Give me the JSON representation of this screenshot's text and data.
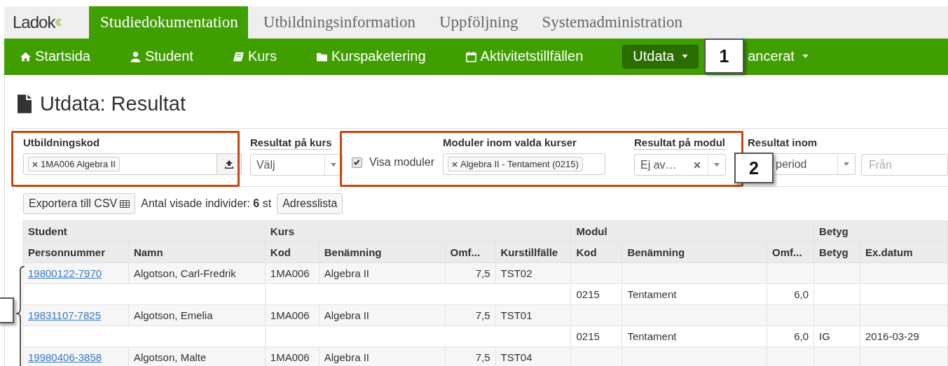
{
  "logo": "Ladok",
  "top_tabs": [
    {
      "label": "Studiedokumentation",
      "selected": true
    },
    {
      "label": "Utbildningsinformation",
      "selected": false
    },
    {
      "label": "Uppföljning",
      "selected": false
    },
    {
      "label": "Systemadministration",
      "selected": false
    }
  ],
  "nav": [
    {
      "label": "Startsida",
      "selected": false,
      "dropdown": false
    },
    {
      "label": "Student",
      "selected": false,
      "dropdown": false
    },
    {
      "label": "Kurs",
      "selected": false,
      "dropdown": false
    },
    {
      "label": "Kurspaketering",
      "selected": false,
      "dropdown": false
    },
    {
      "label": "Aktivitetstillfällen",
      "selected": false,
      "dropdown": false
    },
    {
      "label": "Utdata",
      "selected": true,
      "dropdown": true
    },
    {
      "label": "ancerat",
      "selected": false,
      "dropdown": true
    }
  ],
  "page_title": "Utdata: Resultat",
  "filters": {
    "utbildningskod": {
      "label": "Utbildningskod",
      "tag": "1MA006 Algebra II"
    },
    "resultat_pa_kurs": {
      "label": "Resultat på kurs",
      "value": "Välj"
    },
    "visa_moduler": {
      "label": "Visa moduler",
      "checked": true
    },
    "moduler": {
      "label": "Moduler inom valda kurser",
      "tag": "Algebra II - Tentament (0215)"
    },
    "resultat_pa_modul": {
      "label": "Resultat på modul",
      "value": "Ej av…"
    },
    "resultat_inom": {
      "label": "Resultat inom",
      "value": "period"
    },
    "fran": {
      "placeholder": "Från"
    }
  },
  "toolbar": {
    "export_button": "Exportera till CSV",
    "count": "Antal visade individer: **6** st",
    "address_button": "Adresslista"
  },
  "table": {
    "groups": [
      {
        "label": "Student"
      },
      {
        "label": "Kurs"
      },
      {
        "label": "Modul"
      },
      {
        "label": "Betyg"
      }
    ],
    "columns": [
      "Personnummer",
      "Namn",
      "Kod",
      "Benämning",
      "Omf...",
      "Kurstillfälle",
      "Kod",
      "Benämning",
      "Omf...",
      "Betyg",
      "Ex.datum"
    ],
    "rows": [
      {
        "kind": "course",
        "personnummer": "19800122-7970",
        "namn": "Algotson, Carl-Fredrik",
        "kod": "1MA006",
        "benamning": "Algebra II",
        "omf": "7,5",
        "tillfalle": "TST02"
      },
      {
        "kind": "module",
        "kod": "0215",
        "benamning": "Tentament",
        "omf": "6,0"
      },
      {
        "kind": "course",
        "personnummer": "19831107-7825",
        "namn": "Algotson, Emelia",
        "kod": "1MA006",
        "benamning": "Algebra II",
        "omf": "7,5",
        "tillfalle": "TST01"
      },
      {
        "kind": "module",
        "kod": "0215",
        "benamning": "Tentament",
        "omf": "6,0",
        "betyg": "IG",
        "datum": "2016-03-29"
      },
      {
        "kind": "course",
        "personnummer": "19980406-3858",
        "namn": "Algotson, Malte",
        "kod": "1MA006",
        "benamning": "Algebra II",
        "omf": "7,5",
        "tillfalle": "TST04"
      }
    ]
  },
  "callouts": [
    {
      "label": "1"
    },
    {
      "label": "2"
    }
  ]
}
